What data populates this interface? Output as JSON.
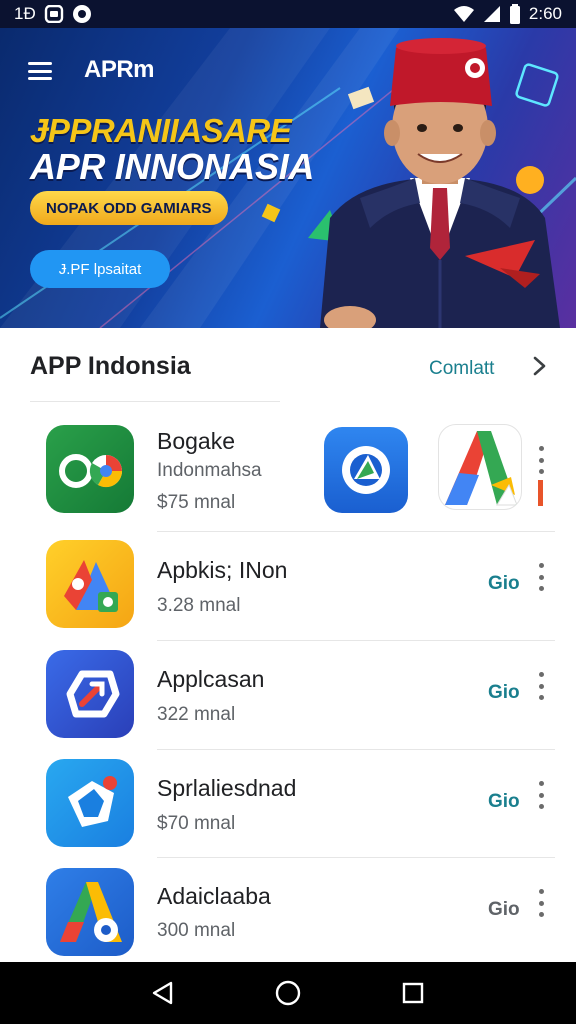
{
  "status_bar": {
    "left_text": "1Ð",
    "time": "2:60"
  },
  "banner": {
    "logo": "APRm",
    "title_line1": "ɈPPRANIIASARE",
    "title_line2": "APR INNONASIA",
    "badge": "NOPAK ODD GAMIARS",
    "cta": "Ɉ.PF lpsaitat"
  },
  "section": {
    "title": "APP Indonsia",
    "link": "Comlatt"
  },
  "apps": [
    {
      "name": "Bogake",
      "subtitle": "Indonmahsa",
      "price": "$75 mnal",
      "action": ""
    },
    {
      "name": "Apbkis; INon",
      "subtitle": "",
      "price": "3.28 mnal",
      "action": "Gio"
    },
    {
      "name": "Applcasan",
      "subtitle": "",
      "price": "322 mnal",
      "action": "Gio"
    },
    {
      "name": "Sprlaliesdnad",
      "subtitle": "",
      "price": "$70 mnal",
      "action": "Gio"
    },
    {
      "name": "Adaiclaaba",
      "subtitle": "",
      "price": "300 mnal",
      "action": "Gio"
    }
  ],
  "icons": {
    "menu": "menu-icon",
    "chevron": "chevron-right-icon",
    "more": "more-vert-icon",
    "back": "nav-back-icon",
    "home": "nav-home-icon",
    "recents": "nav-recents-icon"
  }
}
